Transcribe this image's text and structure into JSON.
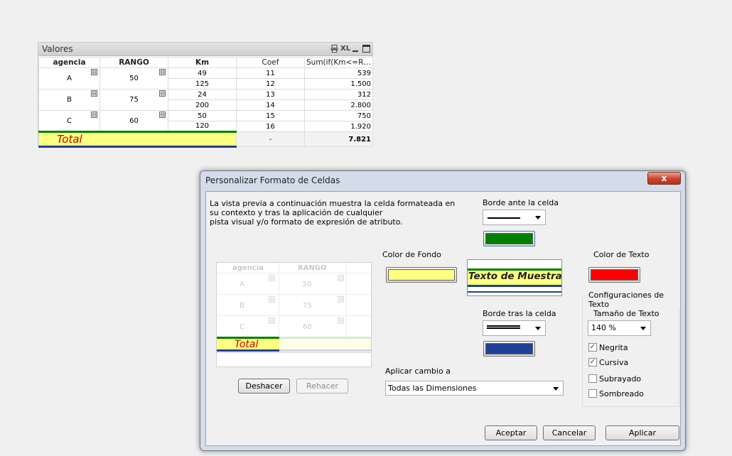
{
  "qv_table": {
    "title": "Valores",
    "caption_icons": [
      "print-icon",
      "xl-icon",
      "minimize-icon",
      "maximize-icon"
    ],
    "xl_label": "XL",
    "headers": [
      "agencia",
      "RANGO",
      "Km",
      "Coef",
      "Sum(if(Km<=R…"
    ],
    "toggle_glyph": "⊟",
    "groups": [
      {
        "agencia": "A",
        "rango": "50",
        "rows": [
          {
            "km": "49",
            "coef": "11",
            "sum": "539"
          },
          {
            "km": "125",
            "coef": "12",
            "sum": "1.500"
          }
        ]
      },
      {
        "agencia": "B",
        "rango": "75",
        "rows": [
          {
            "km": "24",
            "coef": "13",
            "sum": "312"
          },
          {
            "km": "200",
            "coef": "14",
            "sum": "2.800"
          }
        ]
      },
      {
        "agencia": "C",
        "rango": "60",
        "rows": [
          {
            "km": "50",
            "coef": "15",
            "sum": "750"
          },
          {
            "km": "120",
            "coef": "16",
            "sum": "1.920"
          }
        ]
      }
    ],
    "total": {
      "label": "Total",
      "coef": "-",
      "sum": "7.821"
    }
  },
  "dialog": {
    "title": "Personalizar Formato de Celdas",
    "close_label": "x",
    "description": [
      "La vista previa a continuación muestra la celda formateada en",
      "su contexto y tras la aplicación de cualquier",
      "pista visual y/o formato de expresión de atributo."
    ],
    "preview": {
      "headers": [
        "agencia",
        "RANGO"
      ],
      "rows": [
        {
          "agencia": "A",
          "rango": "50"
        },
        {
          "agencia": "B",
          "rango": "75"
        },
        {
          "agencia": "C",
          "rango": "60"
        }
      ],
      "total_label": "Total"
    },
    "undo_label": "Deshacer",
    "redo_label": "Rehacer",
    "border_before": {
      "label": "Borde ante la celda",
      "color": "#008000"
    },
    "border_after": {
      "label": "Borde tras la celda",
      "color": "#1f3f99"
    },
    "background": {
      "label": "Color de Fondo",
      "color": "#ffff80"
    },
    "sample_text": "Texto de Muestra",
    "text_color": {
      "label": "Color de Texto",
      "color": "#ff0000"
    },
    "text_settings": {
      "group_label": "Configuraciones de Texto",
      "size_label": "Tamaño de Texto",
      "size_value": "140 %",
      "options": [
        {
          "label": "Negrita",
          "checked": true
        },
        {
          "label": "Cursiva",
          "checked": true
        },
        {
          "label": "Subrayado",
          "checked": false
        },
        {
          "label": "Sombreado",
          "checked": false
        }
      ]
    },
    "apply_to": {
      "label": "Aplicar cambio a",
      "value": "Todas las Dimensiones"
    },
    "buttons": {
      "ok": "Aceptar",
      "cancel": "Cancelar",
      "apply": "Aplicar"
    },
    "check_glyph": "✓"
  }
}
